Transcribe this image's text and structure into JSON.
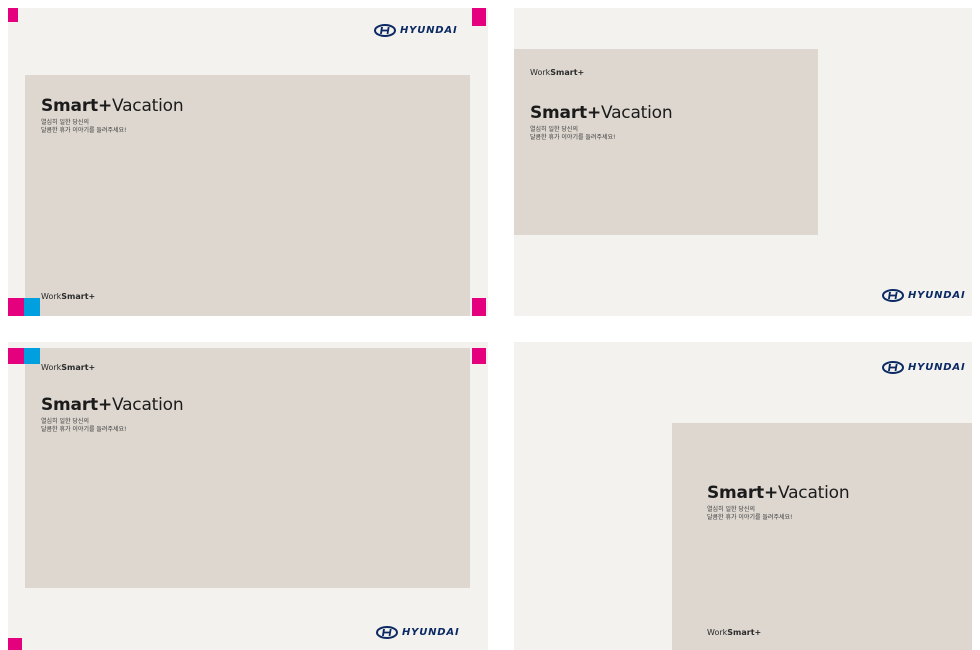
{
  "brand": {
    "logo_text": "HYUNDAI",
    "logo_icon": "hyundai-h-icon"
  },
  "card": {
    "headline_bold": "Smart+",
    "headline_light": "Vacation",
    "sub_line1": "열심히 일한 당신의",
    "sub_line2": "달콤한 휴가 이야기를 들려주세요!",
    "ws_light": "Work",
    "ws_bold": "Smart+"
  },
  "colors": {
    "panel": "#f4f2ef",
    "card": "#ddd7d0",
    "crop_mark_pink": "#e5007e",
    "crop_mark_blue": "#00a0e0",
    "logo": "#0b2a63"
  }
}
